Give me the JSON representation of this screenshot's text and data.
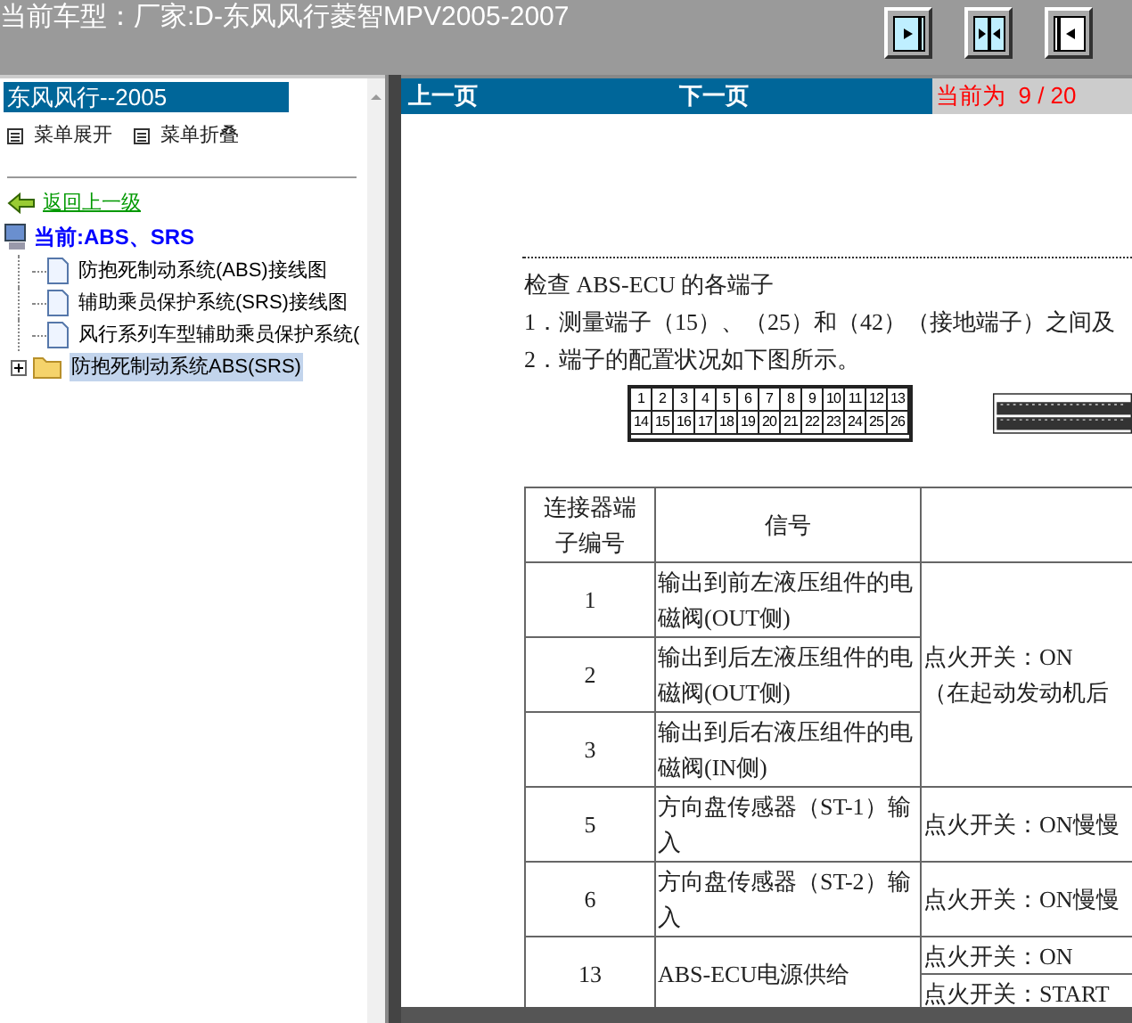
{
  "header": {
    "title": "当前车型：厂家:D-东风风行菱智MPV2005-2007"
  },
  "sidebar": {
    "title": "东风风行--2005",
    "menu_actions": [
      "菜单展开",
      "菜单折叠"
    ],
    "back_link": "返回上一级",
    "current": "当前:ABS、SRS",
    "tree": [
      {
        "kind": "document",
        "label": "防抱死制动系统(ABS)接线图",
        "selected": false
      },
      {
        "kind": "document",
        "label": "辅助乘员保护系统(SRS)接线图",
        "selected": false
      },
      {
        "kind": "document",
        "label": "风行系列车型辅助乘员保护系统(",
        "selected": false
      },
      {
        "kind": "folder",
        "label": "防抱死制动系统ABS(SRS)",
        "selected": true,
        "expanded": false
      }
    ]
  },
  "pager": {
    "prev": "上一页",
    "next": "下一页",
    "position": "当前为  9 / 20"
  },
  "document": {
    "heading": "检查 ABS-ECU 的各端子",
    "lines": [
      "1．测量端子（15）、（25）和（42）（接地端子）之间及",
      "2．端子的配置状况如下图所示。"
    ],
    "connector_pins": [
      [
        "1",
        "2",
        "3",
        "4",
        "5",
        "6",
        "7",
        "8",
        "9",
        "10",
        "11",
        "12",
        "13"
      ],
      [
        "14",
        "15",
        "16",
        "17",
        "18",
        "19",
        "20",
        "21",
        "22",
        "23",
        "24",
        "25",
        "26"
      ]
    ],
    "table": {
      "columns": [
        "连接器端子编号",
        "信号"
      ],
      "groups": [
        {
          "rows": [
            {
              "terminal": "1",
              "signal": "输出到前左液压组件的电磁阀(OUT侧)"
            },
            {
              "terminal": "2",
              "signal": "输出到后左液压组件的电磁阀(OUT侧)"
            },
            {
              "terminal": "3",
              "signal": "输出到后右液压组件的电磁阀(IN侧)"
            }
          ],
          "conditions": [
            [
              "点火开关：ON",
              "（在起动发动机后"
            ]
          ]
        },
        {
          "rows": [
            {
              "terminal": "5",
              "signal": "方向盘传感器（ST-1）输入"
            }
          ],
          "conditions": [
            [
              "点火开关：ON慢慢"
            ]
          ]
        },
        {
          "rows": [
            {
              "terminal": "6",
              "signal": "方向盘传感器（ST-2）输入"
            }
          ],
          "conditions": [
            [
              "点火开关：ON慢慢"
            ]
          ]
        },
        {
          "rows": [
            {
              "terminal": "13",
              "signal": "ABS-ECU电源供给"
            }
          ],
          "conditions": [
            [
              "点火开关：ON"
            ],
            [
              "点火开关：START"
            ]
          ]
        }
      ]
    }
  }
}
